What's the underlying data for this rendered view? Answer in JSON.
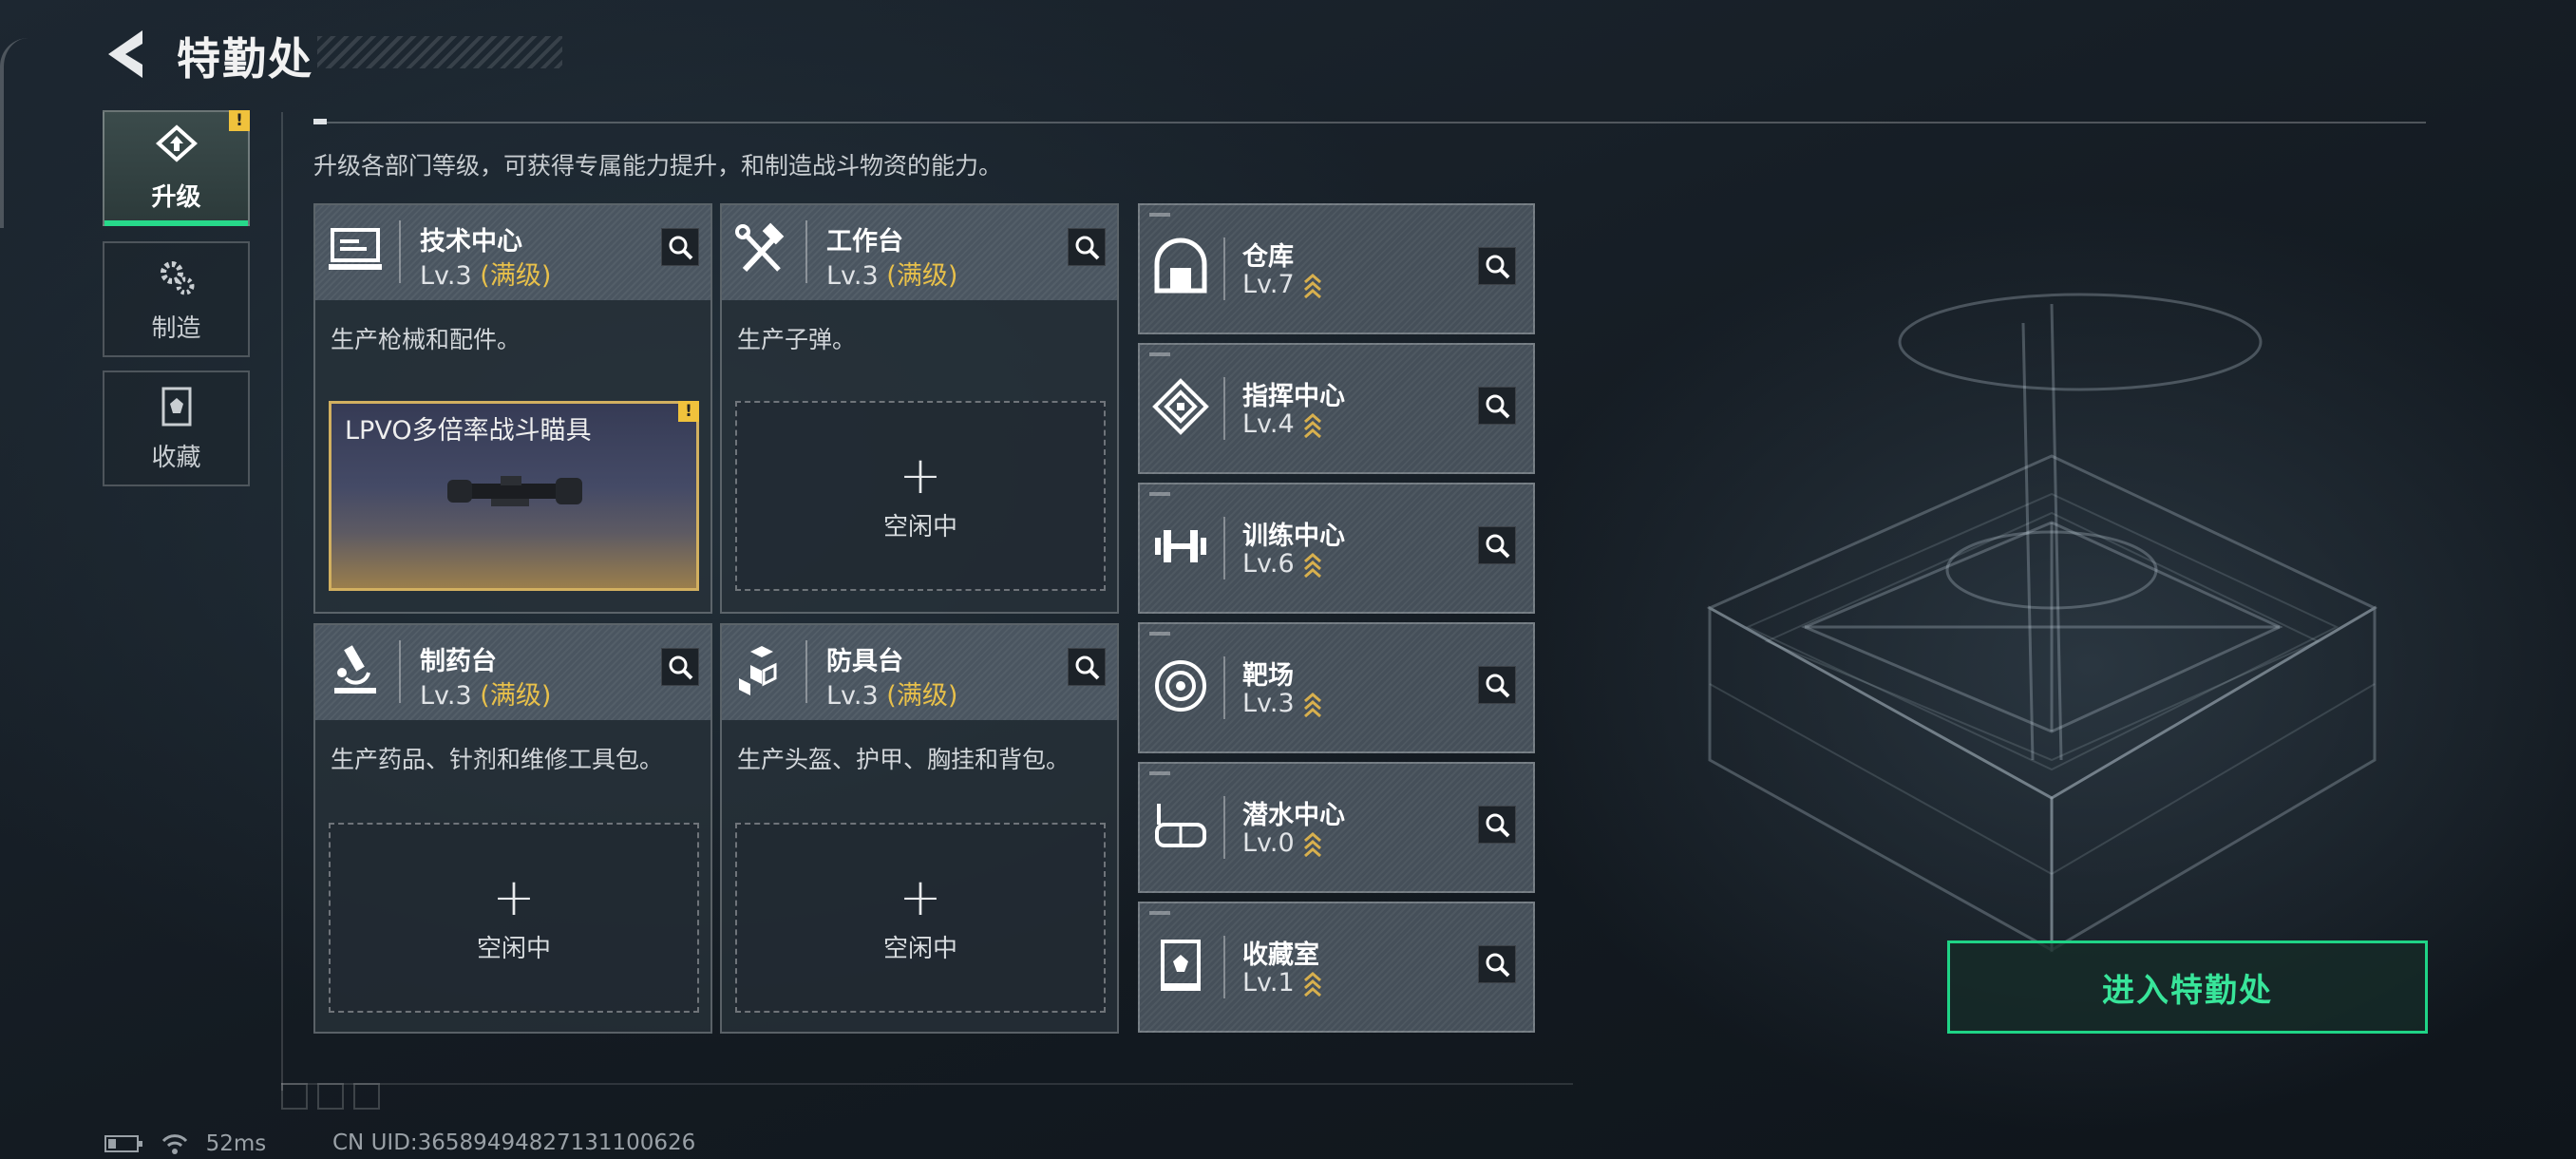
{
  "header": {
    "title": "特勤处"
  },
  "subtitle": "升级各部门等级，可获得专属能力提升，和制造战斗物资的能力。",
  "nav": [
    {
      "label": "升级",
      "active": true,
      "alert": "!"
    },
    {
      "label": "制造",
      "active": false
    },
    {
      "label": "收藏",
      "active": false
    }
  ],
  "departments": [
    {
      "name": "技术中心",
      "level": "Lv.3",
      "max_tag": "(满级)",
      "desc": "生产枪械和配件。",
      "producing": {
        "item": "LPVO多倍率战斗瞄具",
        "alert": "!"
      }
    },
    {
      "name": "工作台",
      "level": "Lv.3",
      "max_tag": "(满级)",
      "desc": "生产子弹。",
      "idle_plus": "+",
      "idle": "空闲中"
    },
    {
      "name": "制药台",
      "level": "Lv.3",
      "max_tag": "(满级)",
      "desc": "生产药品、针剂和维修工具包。",
      "idle_plus": "+",
      "idle": "空闲中"
    },
    {
      "name": "防具台",
      "level": "Lv.3",
      "max_tag": "(满级)",
      "desc": "生产头盔、护甲、胸挂和背包。",
      "idle_plus": "+",
      "idle": "空闲中"
    }
  ],
  "facilities": [
    {
      "name": "仓库",
      "level": "Lv.7",
      "icon": "vault-icon"
    },
    {
      "name": "指挥中心",
      "level": "Lv.4",
      "icon": "command-icon"
    },
    {
      "name": "训练中心",
      "level": "Lv.6",
      "icon": "dumbbell-icon"
    },
    {
      "name": "靶场",
      "level": "Lv.3",
      "icon": "target-icon"
    },
    {
      "name": "潜水中心",
      "level": "Lv.0",
      "icon": "goggles-icon"
    },
    {
      "name": "收藏室",
      "level": "Lv.1",
      "icon": "showcase-icon"
    }
  ],
  "enter_button": "进入特勤处",
  "status": {
    "ping": "52ms",
    "uid": "CN UID:36589494827131100626"
  },
  "colors": {
    "accent_green": "#27d98a",
    "max_gold": "#e8c04a",
    "alert_yellow": "#f0c23c"
  }
}
